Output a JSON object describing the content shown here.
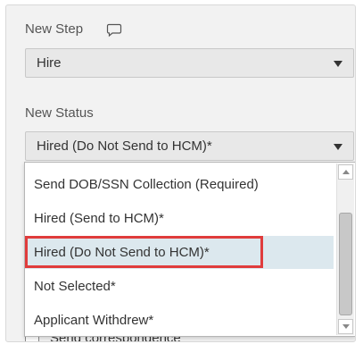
{
  "form": {
    "new_step": {
      "label": "New Step",
      "comment_icon": "comment-icon",
      "value": "Hire"
    },
    "new_status": {
      "label": "New Status",
      "value": "Hired (Do Not Send to HCM)*",
      "options": [
        "Send DOB/SSN Collection (Required)",
        "Hired (Send to HCM)*",
        "Hired (Do Not Send to HCM)*",
        "Not Selected*",
        "Applicant Withdrew*"
      ],
      "selected_index": 2
    },
    "send_correspondence": {
      "label": "Send correspondence",
      "checked": false
    }
  },
  "colors": {
    "highlight_border": "#e03c3c",
    "selected_option_bg": "#dce8ee"
  }
}
